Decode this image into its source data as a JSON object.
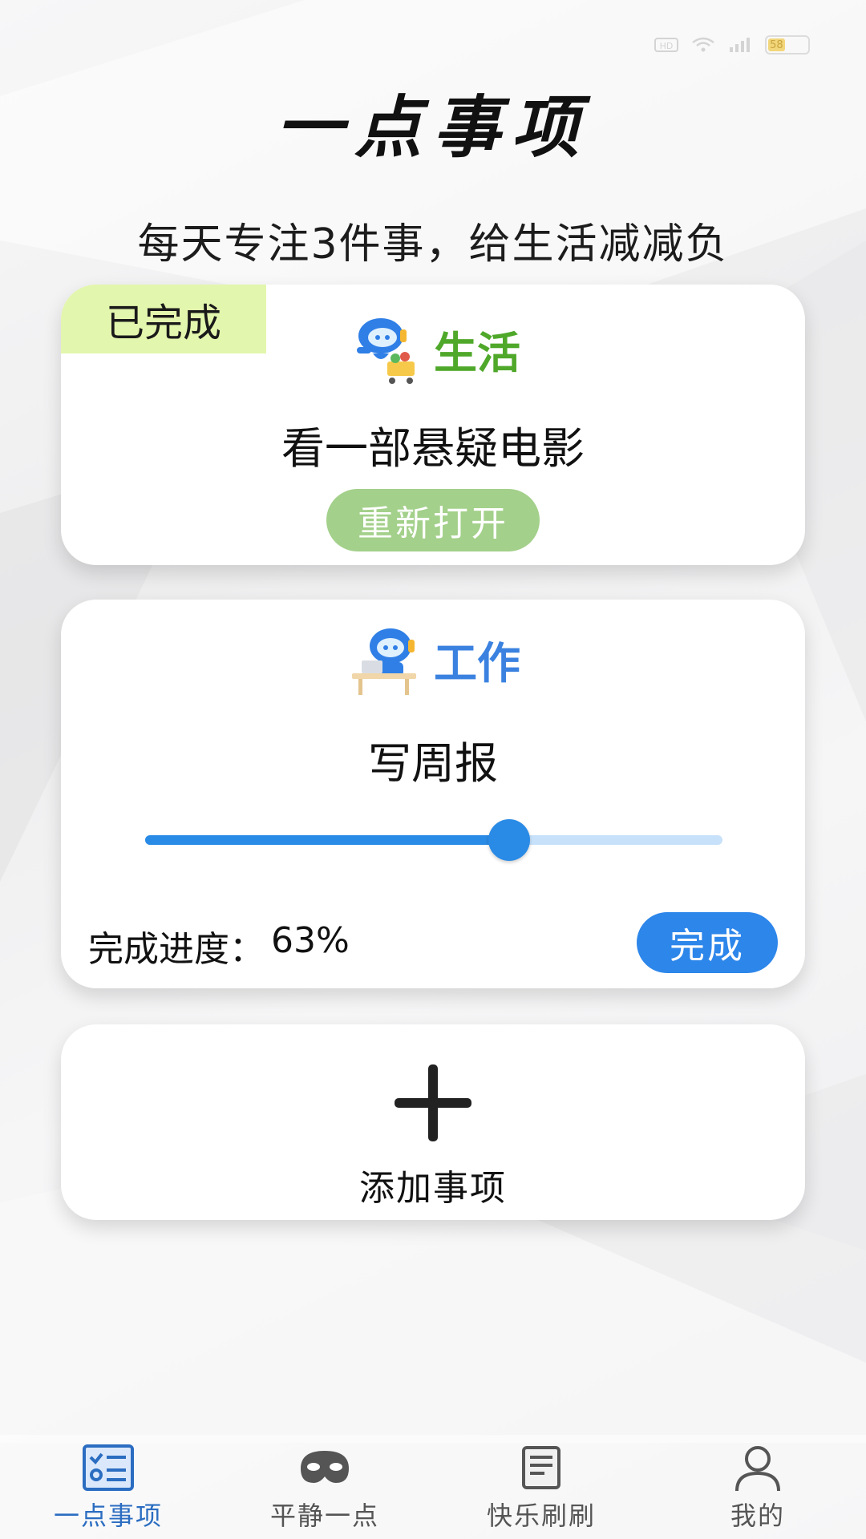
{
  "status_bar": {
    "icons": [
      "hd-icon",
      "wifi-icon",
      "signal-icon",
      "battery-icon"
    ],
    "battery_level": "58"
  },
  "header": {
    "title": "一点事项",
    "subtitle": "每天专注3件事，给生活减减负"
  },
  "tasks": [
    {
      "status_badge": "已完成",
      "category": "生活",
      "category_color": "#4fa82a",
      "title": "看一部悬疑电影",
      "action_label": "重新打开"
    },
    {
      "category": "工作",
      "category_color": "#3b82e0",
      "title": "写周报",
      "progress_label": "完成进度：",
      "progress_value": "63%",
      "progress_fraction": 0.63,
      "action_label": "完成"
    }
  ],
  "add_card": {
    "label": "添加事项"
  },
  "tabbar": {
    "items": [
      {
        "label": "一点事项",
        "icon": "checklist-icon",
        "active": true
      },
      {
        "label": "平静一点",
        "icon": "mask-icon",
        "active": false
      },
      {
        "label": "快乐刷刷",
        "icon": "notebook-icon",
        "active": false
      },
      {
        "label": "我的",
        "icon": "person-icon",
        "active": false
      }
    ]
  },
  "colors": {
    "accent_blue": "#2d86ea",
    "badge_green": "#e3f6ad",
    "reopen_green": "#a3d08a"
  }
}
